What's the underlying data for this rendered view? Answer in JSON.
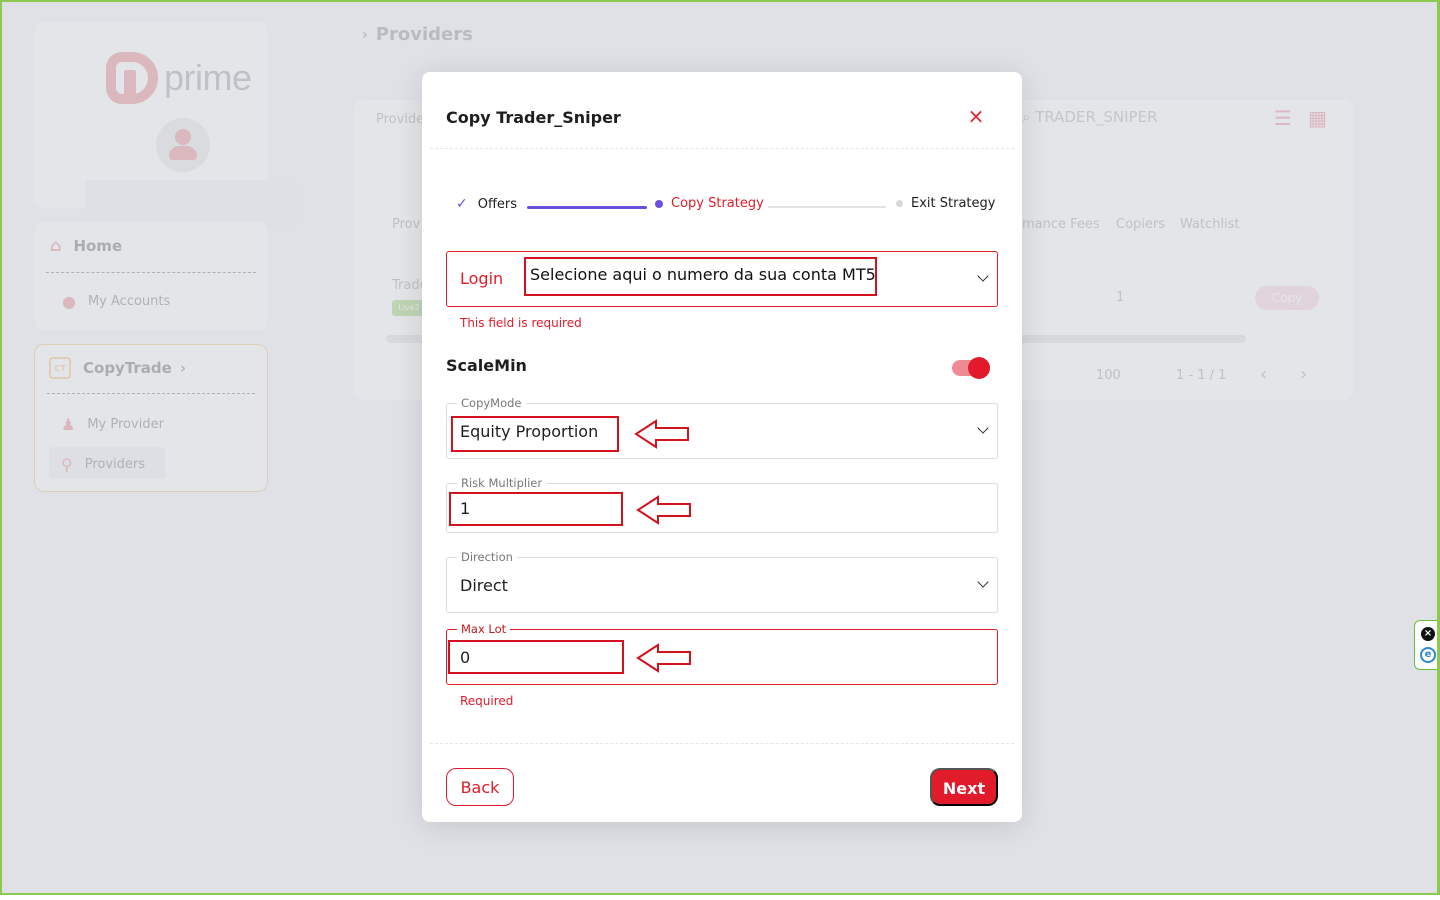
{
  "app": {
    "logo_text": "prime",
    "breadcrumb": "Providers"
  },
  "sidebar": {
    "home": {
      "label": "Home",
      "icon": "home-icon"
    },
    "my_accounts": {
      "label": "My Accounts",
      "icon": "user-icon"
    },
    "copytrade": {
      "label": "CopyTrade",
      "badge": "CT",
      "icon": "chevron-right-icon"
    },
    "my_provider": {
      "label": "My Provider",
      "icon": "users-icon"
    },
    "providers": {
      "label": "Providers",
      "icon": "antenna-icon"
    }
  },
  "background": {
    "filter_label": "Provider",
    "search_value": "TRADER_SNIPER",
    "col_provider": "Prov",
    "col_fees": "mance Fees",
    "col_copiers": "Copiers",
    "col_watchlist": "Watchlist",
    "row_name": "Trade",
    "row_badge": "Live2",
    "row_copiers": "1",
    "row_button": "Copy",
    "per_page": "100",
    "pagination": "1 - 1 / 1"
  },
  "modal": {
    "title": "Copy Trader_Sniper",
    "close_symbol": "×",
    "stepper": {
      "step1": "Offers",
      "step2": "Copy Strategy",
      "step3": "Exit Strategy"
    },
    "login": {
      "label": "Login",
      "annotation": "Selecione aqui o numero da sua conta MT5",
      "error": "This field is required"
    },
    "scale_min": {
      "label": "ScaleMin",
      "enabled": true
    },
    "copy_mode": {
      "label": "CopyMode",
      "value": "Equity Proportion"
    },
    "risk_multiplier": {
      "label": "Risk Multiplier",
      "value": "1"
    },
    "direction": {
      "label": "Direction",
      "value": "Direct"
    },
    "max_lot": {
      "label": "Max Lot",
      "value": "0",
      "error": "Required"
    },
    "back_label": "Back",
    "next_label": "Next"
  },
  "colors": {
    "accent_red": "#e21b2a",
    "stepper_purple": "#6a4fe0",
    "annotation_red": "#d4111f",
    "frame_green": "#8ec94f"
  }
}
